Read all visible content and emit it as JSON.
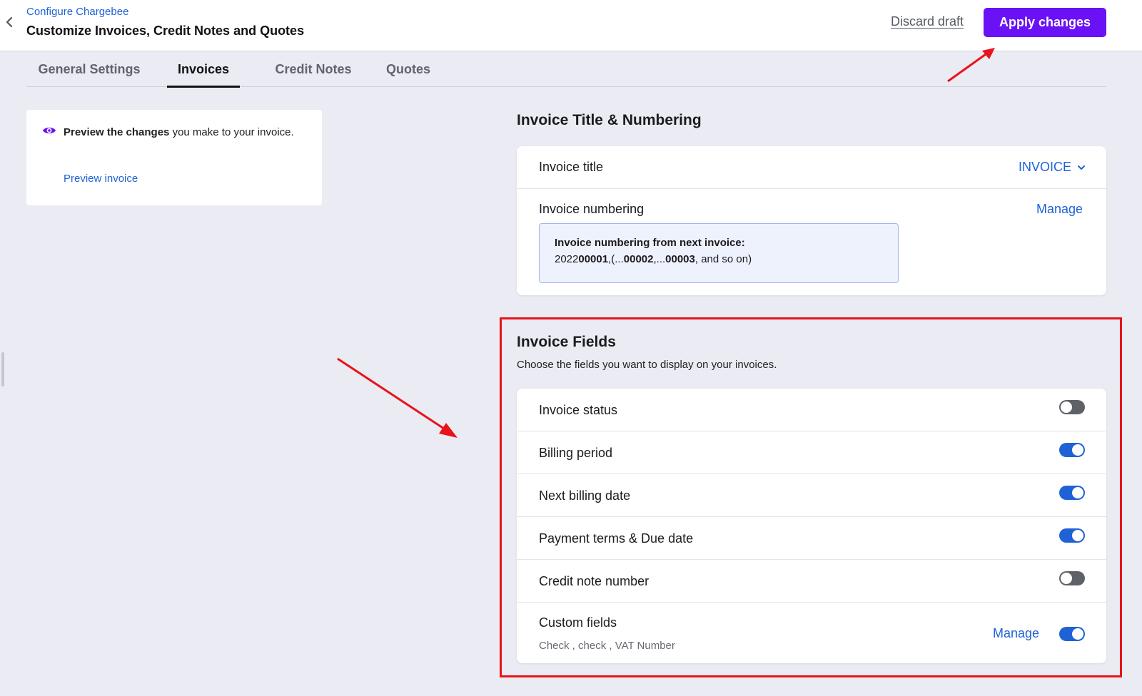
{
  "header": {
    "breadcrumb": "Configure Chargebee",
    "title": "Customize Invoices, Credit Notes and Quotes",
    "discard_label": "Discard draft",
    "apply_label": "Apply changes",
    "apply_color": "#6a12f5"
  },
  "tabs": [
    {
      "label": "General Settings",
      "active": false
    },
    {
      "label": "Invoices",
      "active": true
    },
    {
      "label": "Credit Notes",
      "active": false
    },
    {
      "label": "Quotes",
      "active": false
    }
  ],
  "preview": {
    "bold_text": "Preview the changes",
    "rest_text": " you make to your invoice.",
    "link_label": "Preview invoice",
    "icon": "eye-icon"
  },
  "title_numbering": {
    "heading": "Invoice Title & Numbering",
    "invoice_title_label": "Invoice title",
    "invoice_title_value": "INVOICE",
    "numbering_label": "Invoice numbering",
    "manage_label": "Manage",
    "numbering_box_heading": "Invoice numbering from next invoice:",
    "numbering_prefix": "2022",
    "numbering_first": "00001",
    "numbering_mid1": ",(...",
    "numbering_second": "00002",
    "numbering_mid2": ",...",
    "numbering_third": "00003",
    "numbering_suffix": ", and so on)"
  },
  "invoice_fields": {
    "heading": "Invoice Fields",
    "description": "Choose the fields you want to display on your invoices.",
    "rows": [
      {
        "label": "Invoice status",
        "enabled": false
      },
      {
        "label": "Billing period",
        "enabled": true
      },
      {
        "label": "Next billing date",
        "enabled": true
      },
      {
        "label": "Payment terms & Due date",
        "enabled": true
      },
      {
        "label": "Credit note number",
        "enabled": false
      },
      {
        "label": "Custom fields",
        "enabled": true,
        "sub": "Check , check , VAT Number",
        "manage_label": "Manage"
      }
    ]
  },
  "colors": {
    "link": "#1e62d6",
    "toggle_on": "#1e62d6",
    "toggle_off": "#5f6168",
    "annotation": "#e8131b"
  }
}
